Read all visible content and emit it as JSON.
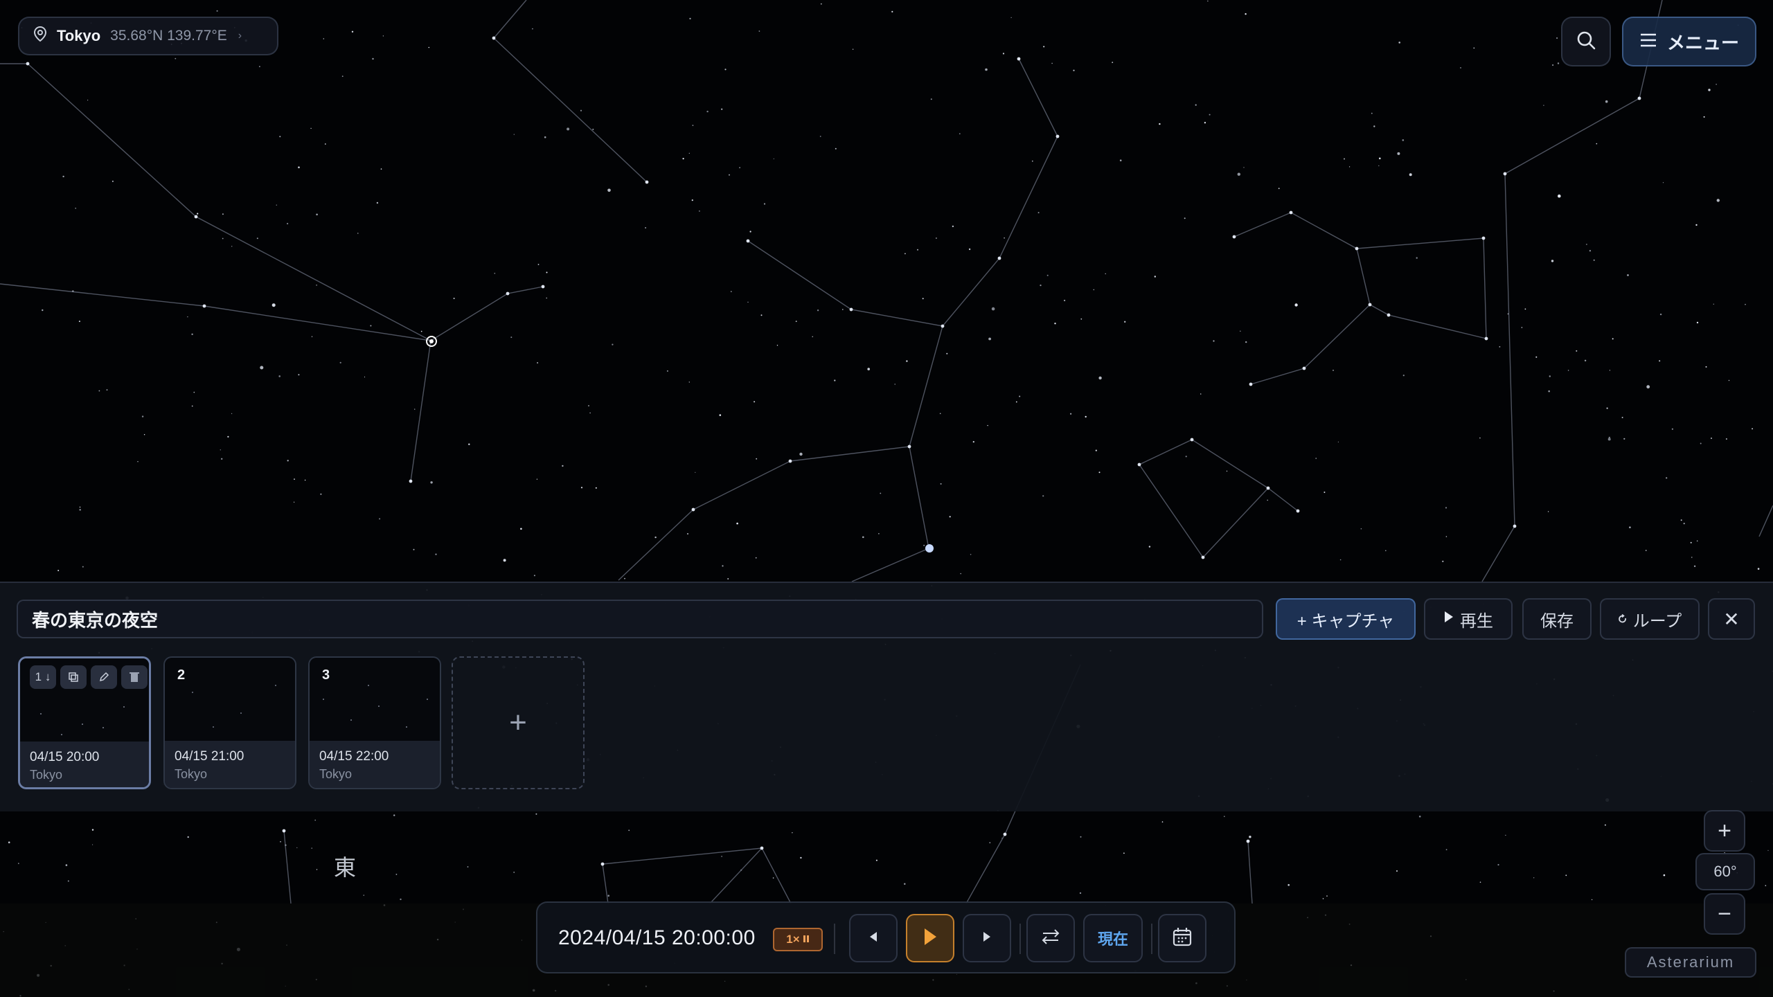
{
  "location": {
    "city": "Tokyo",
    "coords": "35.68°N 139.77°E",
    "chevron": "›"
  },
  "header": {
    "menu_label": "メニュー"
  },
  "tour": {
    "title": "春の東京の夜空",
    "buttons": {
      "capture": "+ キャプチャ",
      "play": "再生",
      "save": "保存",
      "loop": "ループ",
      "close": "✕"
    },
    "slides": [
      {
        "number": "1",
        "date": "04/15 20:00",
        "place": "Tokyo",
        "active": true
      },
      {
        "number": "2",
        "date": "04/15 21:00",
        "place": "Tokyo",
        "active": false
      },
      {
        "number": "3",
        "date": "04/15 22:00",
        "place": "Tokyo",
        "active": false
      }
    ],
    "slide_tools": {
      "order": "1 ↓"
    },
    "add_slide": "+"
  },
  "compass": {
    "east": "東"
  },
  "zoom": {
    "in": "+",
    "level": "60°",
    "out": "−"
  },
  "brand": "Asterarium",
  "timebar": {
    "datetime": "2024/04/15 20:00:00",
    "speed": "1×",
    "now_label": "現在"
  },
  "icons": [
    "location-pin-icon",
    "search-icon",
    "hamburger-icon",
    "copy-icon",
    "pencil-icon",
    "trash-icon",
    "play-icon",
    "loop-icon",
    "close-icon",
    "plus-icon",
    "prev-icon",
    "next-icon",
    "reverse-icon",
    "calendar-icon",
    "pause-icon"
  ]
}
